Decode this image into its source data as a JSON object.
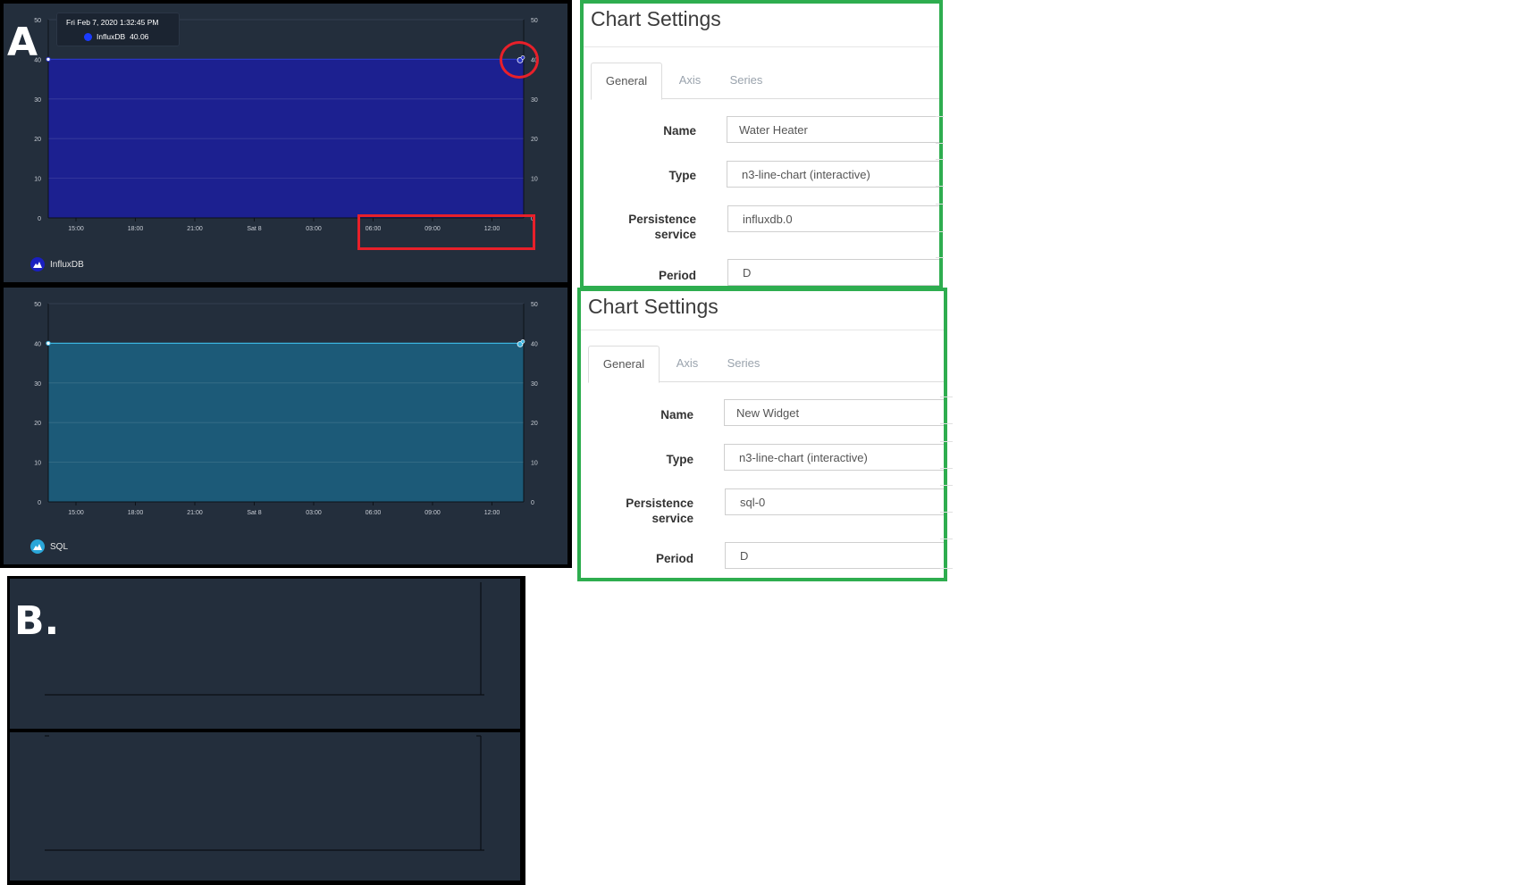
{
  "panel_a": {
    "letter": "A",
    "chart_top": {
      "type": "area",
      "y_ticks": [
        "0",
        "10",
        "20",
        "30",
        "40",
        "50"
      ],
      "x_ticks": [
        "15:00",
        "18:00",
        "21:00",
        "Sat 8",
        "03:00",
        "06:00",
        "09:00",
        "12:00"
      ],
      "ylim": [
        0,
        50
      ],
      "series_value": 40,
      "fill_color": "#1c2090",
      "line_color": "#2a36c8",
      "legend": "InfluxDB",
      "legend_color": "#1a1fc0",
      "tooltip": {
        "time": "Fri Feb 7, 2020 1:32:45 PM",
        "series": "InfluxDB",
        "value": "40.06"
      }
    },
    "chart_bottom": {
      "type": "area",
      "y_ticks": [
        "0",
        "10",
        "20",
        "30",
        "40",
        "50"
      ],
      "x_ticks": [
        "15:00",
        "18:00",
        "21:00",
        "Sat 8",
        "03:00",
        "06:00",
        "09:00",
        "12:00"
      ],
      "ylim": [
        0,
        50
      ],
      "series_value": 40,
      "fill_color": "#1c5a78",
      "line_color": "#3ab4e0",
      "legend": "SQL",
      "legend_color": "#2aa6d8"
    }
  },
  "panel_b": {
    "letter": "B."
  },
  "settings": [
    {
      "title": "Chart Settings",
      "tabs": [
        "General",
        "Axis",
        "Series"
      ],
      "fields": {
        "name_label": "Name",
        "name_value": "Water Heater",
        "type_label": "Type",
        "type_value": "n3-line-chart (interactive)",
        "persistence_label_1": "Persistence",
        "persistence_label_2": "service",
        "persistence_value": "influxdb.0",
        "period_label": "Period",
        "period_value": "D"
      }
    },
    {
      "title": "Chart Settings",
      "tabs": [
        "General",
        "Axis",
        "Series"
      ],
      "fields": {
        "name_label": "Name",
        "name_value": "New Widget",
        "type_label": "Type",
        "type_value": "n3-line-chart (interactive)",
        "persistence_label_1": "Persistence",
        "persistence_label_2": "service",
        "persistence_value": "sql-0",
        "period_label": "Period",
        "period_value": "D"
      }
    }
  ],
  "chart_data": [
    {
      "type": "area",
      "title": "",
      "x": [
        "15:00",
        "18:00",
        "21:00",
        "Sat 8",
        "03:00",
        "06:00",
        "09:00",
        "12:00"
      ],
      "series": [
        {
          "name": "InfluxDB",
          "values": [
            40,
            40,
            40,
            40,
            40,
            40,
            40,
            40
          ]
        }
      ],
      "ylim": [
        0,
        50
      ],
      "grid": true,
      "legend": "bottom-left"
    },
    {
      "type": "area",
      "title": "",
      "x": [
        "15:00",
        "18:00",
        "21:00",
        "Sat 8",
        "03:00",
        "06:00",
        "09:00",
        "12:00"
      ],
      "series": [
        {
          "name": "SQL",
          "values": [
            40,
            40,
            40,
            40,
            40,
            40,
            40,
            40
          ]
        }
      ],
      "ylim": [
        0,
        50
      ],
      "grid": true,
      "legend": "bottom-left"
    }
  ]
}
